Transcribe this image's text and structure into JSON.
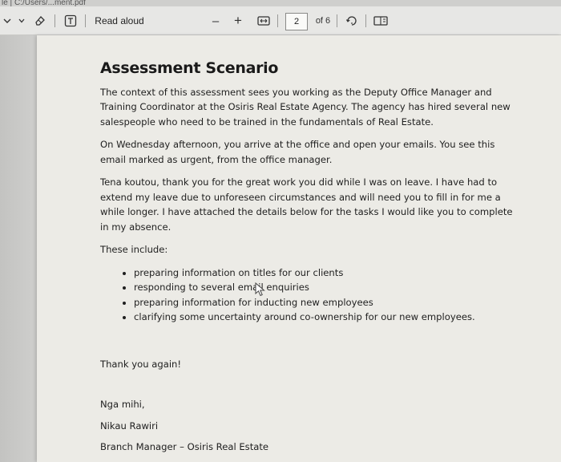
{
  "top_strip": {
    "text": "le  |  C:/Users/...ment.pdf"
  },
  "toolbar": {
    "read_aloud_label": "Read aloud",
    "zoom_out_label": "–",
    "zoom_in_label": "+",
    "current_page": "2",
    "page_of_label": "of 6"
  },
  "document": {
    "title": "Assessment Scenario",
    "paragraphs": [
      "The context of this assessment sees you working as the Deputy Office Manager and Training Coordinator at the Osiris Real Estate Agency. The agency has hired several new salespeople who need to be trained in the fundamentals of Real Estate.",
      "On Wednesday afternoon, you arrive at the office and open your emails. You see this email marked as urgent, from the office manager.",
      "Tena koutou, thank you for the great work you did while I was on leave. I have had to extend my leave due to unforeseen circumstances and will need you to fill in for me a while longer. I have attached the details below for the tasks I would like you to complete in my absence.",
      "These include:"
    ],
    "bullets": [
      "preparing information on titles for our clients",
      "responding to several email enquiries",
      "preparing information for inducting new employees",
      "clarifying some uncertainty around co-ownership for our new employees."
    ],
    "thanks": "Thank you again!",
    "signoff": "Nga mihi,",
    "signer_name": "Nikau Rawiri",
    "signer_title": "Branch Manager – Osiris Real Estate"
  }
}
